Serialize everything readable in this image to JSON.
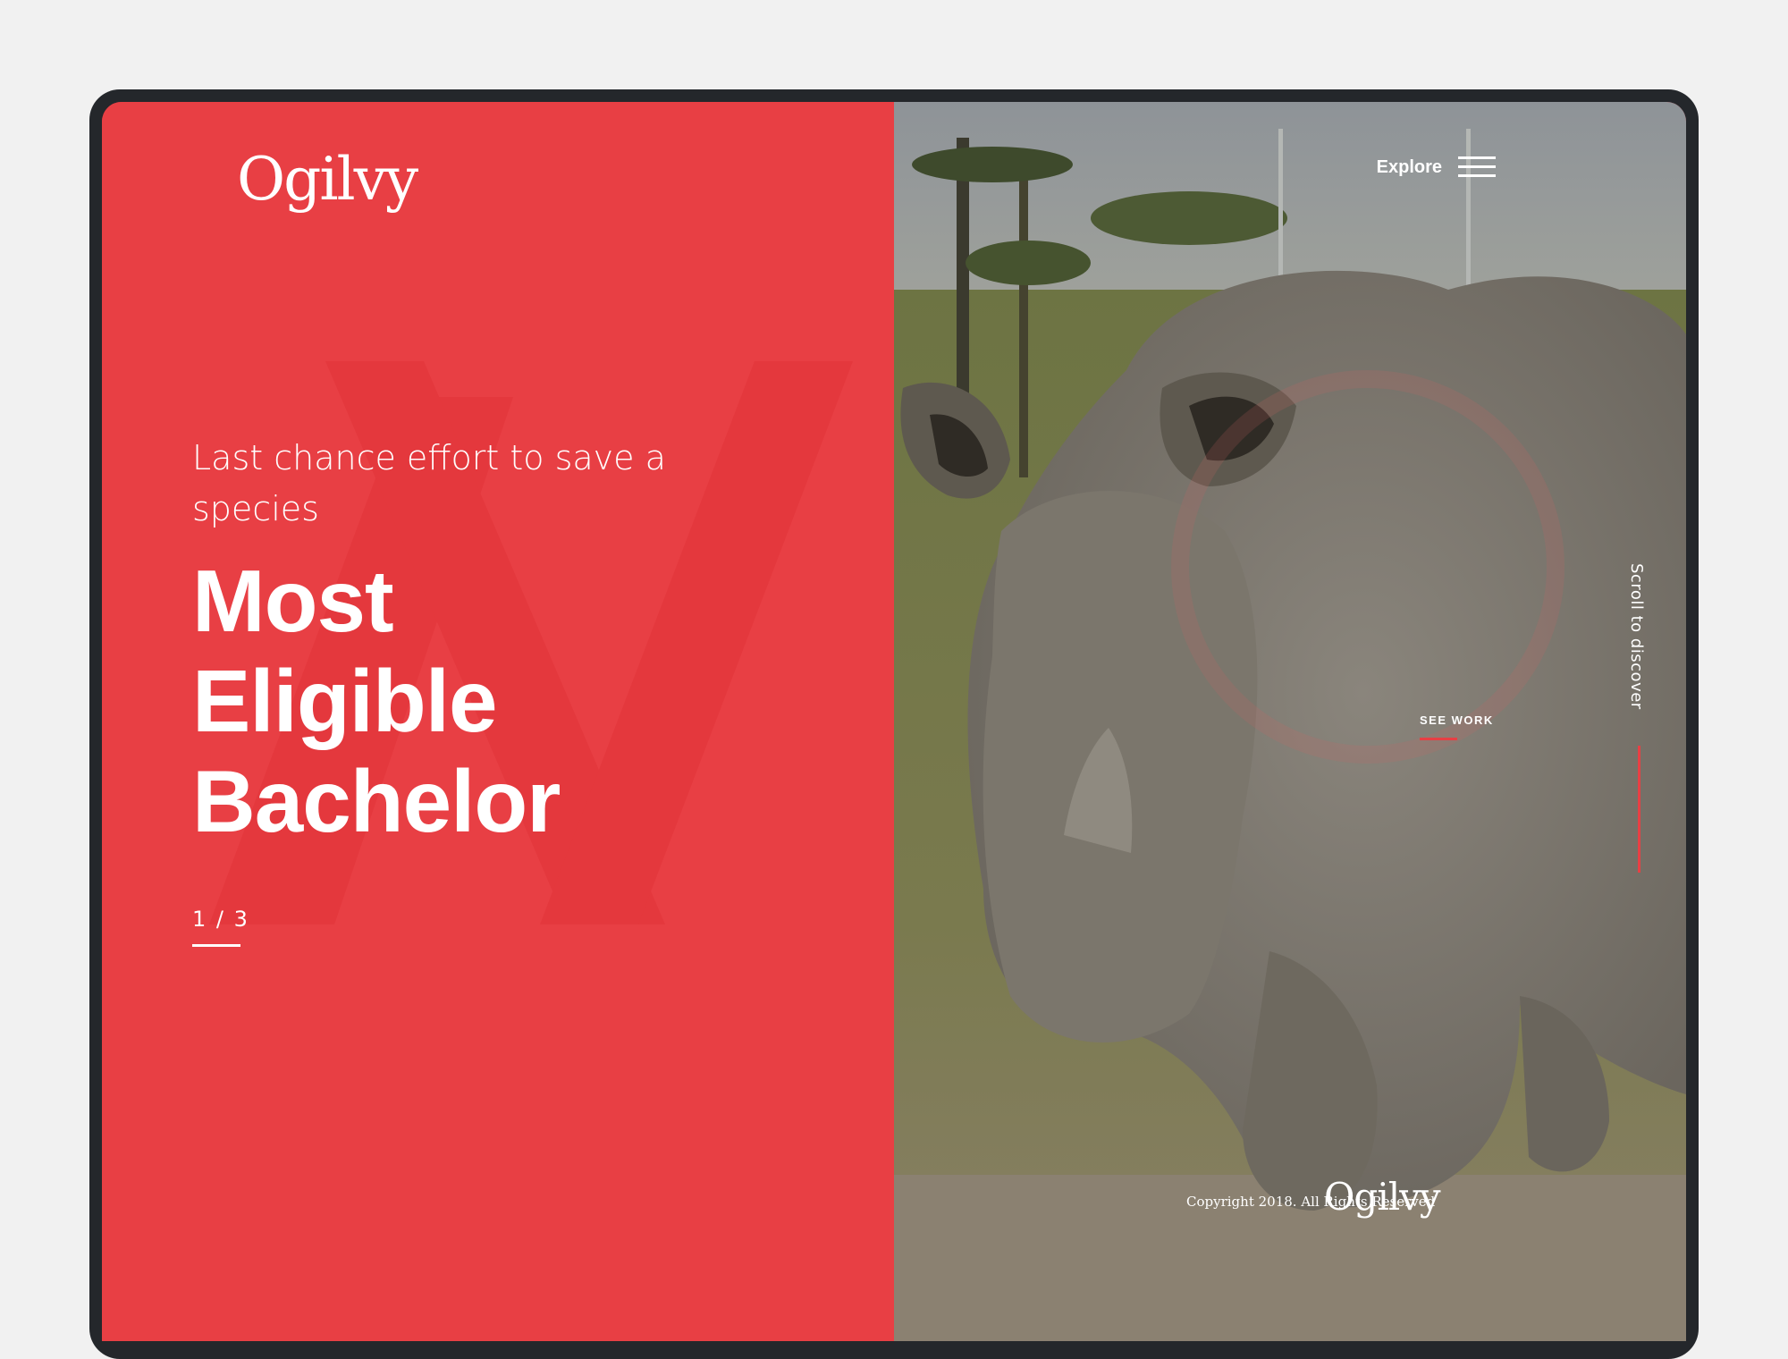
{
  "brand": {
    "logo_text": "Ogilvy",
    "footer_logo_text": "Ogilvy"
  },
  "nav": {
    "explore_label": "Explore",
    "menu_icon": "hamburger-menu-icon"
  },
  "hero": {
    "subtitle": "Last chance effort to save a species",
    "headline_lines": [
      "Most",
      "Eligible",
      "Bachelor"
    ],
    "slide_counter": "1 / 3",
    "background_letter": "W"
  },
  "photo": {
    "subject": "rhino-photo"
  },
  "actions": {
    "see_work_label": "SEE WORK",
    "scroll_label": "Scroll to discover"
  },
  "footer": {
    "copyright": "Copyright 2018. All Rights Reserved"
  },
  "colors": {
    "accent": "#e83f44",
    "device_frame": "#24272b",
    "page_bg": "#f1f1f1"
  }
}
